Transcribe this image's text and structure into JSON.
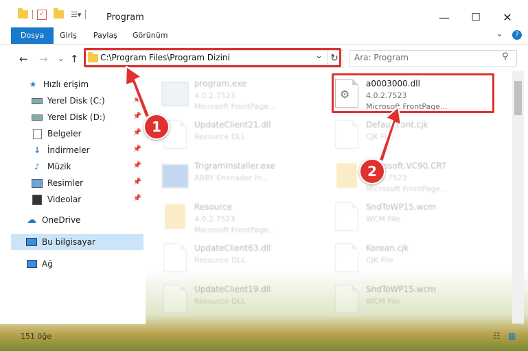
{
  "window": {
    "title": "Program",
    "minimize_glyph": "—",
    "maximize_glyph": "☐",
    "close_glyph": "✕"
  },
  "ribbon": {
    "tabs": [
      {
        "label": "Dosya",
        "active": true
      },
      {
        "label": "Giriş"
      },
      {
        "label": "Paylaş"
      },
      {
        "label": "Görünüm"
      }
    ],
    "expand_glyph": "⌄",
    "help_glyph": "?"
  },
  "address": {
    "path": "C:\\Program Files\\Program Dizini",
    "dropdown_glyph": "⌄",
    "refresh_glyph": "↻",
    "search_placeholder": "Ara: Program",
    "search_glyph": "⚲"
  },
  "nav": {
    "back_glyph": "←",
    "forward_glyph": "→",
    "recent_glyph": "⌄",
    "up_glyph": "↑"
  },
  "sidebar": {
    "items": [
      {
        "label": "Hızlı erişim",
        "icon": "star-icon"
      },
      {
        "label": "Yerel Disk (C:)",
        "icon": "drive-icon",
        "pinned": true
      },
      {
        "label": "Yerel Disk (D:)",
        "icon": "drive-icon",
        "pinned": true
      },
      {
        "label": "Belgeler",
        "icon": "documents-icon",
        "pinned": true
      },
      {
        "label": "İndirmeler",
        "icon": "download-icon",
        "pinned": true
      },
      {
        "label": "Müzik",
        "icon": "music-icon",
        "pinned": true
      },
      {
        "label": "Resimler",
        "icon": "pictures-icon",
        "pinned": true
      },
      {
        "label": "Videolar",
        "icon": "videos-icon",
        "pinned": true
      },
      {
        "label": "OneDrive",
        "icon": "cloud-icon"
      },
      {
        "label": "Bu bilgisayar",
        "icon": "computer-icon",
        "selected": true
      },
      {
        "label": "Ağ",
        "icon": "network-icon"
      }
    ]
  },
  "files": [
    {
      "name": "program.exe",
      "line1": "4.0.2.7523",
      "line2": "Microsoft FrontPage...",
      "icon": "exe-icon"
    },
    {
      "name": "a0003000.dll",
      "line1": "4.0.2.7523",
      "line2": "Microsoft FrontPage...",
      "icon": "dll-gear-icon",
      "highlighted": true
    },
    {
      "name": "UpdateClient21.dll",
      "line1": "Resource DLL",
      "line2": "",
      "icon": "dll-icon"
    },
    {
      "name": "DefaultFont.cjk",
      "line1": "CJK File",
      "line2": "",
      "icon": "file-icon"
    },
    {
      "name": "TrigramInstaller.exe",
      "line1": "ABBY Ensnader In...",
      "line2": "",
      "icon": "installer-icon"
    },
    {
      "name": "Microsoft.VC90.CRT",
      "line1": "4.0.2.7523",
      "line2": "Microsoft FrontPage...",
      "icon": "folder-icon"
    },
    {
      "name": "Resource",
      "line1": "4.0.2.7523",
      "line2": "Microsoft FrontPage...",
      "icon": "folder-icon"
    },
    {
      "name": "SndToWP15.wcm",
      "line1": "WCM File",
      "line2": "",
      "icon": "file-icon"
    },
    {
      "name": "UpdateClient63.dll",
      "line1": "Resource DLL",
      "line2": "",
      "icon": "dll-icon"
    },
    {
      "name": "Korean.cjk",
      "line1": "CJK File",
      "line2": "",
      "icon": "file-icon"
    },
    {
      "name": "UpdateClient19.dll",
      "line1": "Resource DLL",
      "line2": "",
      "icon": "dll-icon"
    },
    {
      "name": "SndToWP15.wcm",
      "line1": "WCM File",
      "line2": "",
      "icon": "file-icon"
    }
  ],
  "status": {
    "item_count": "151 öğe"
  },
  "annotations": {
    "step1": "1",
    "step2": "2",
    "color": "#e0312f"
  }
}
